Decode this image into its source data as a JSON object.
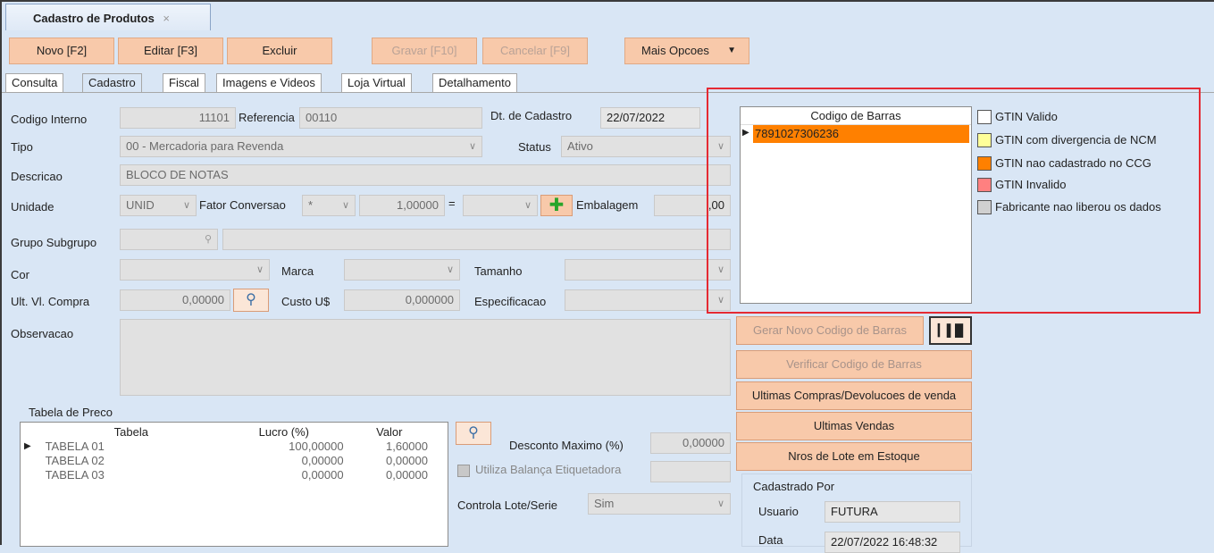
{
  "window": {
    "tab_title": "Cadastro de Produtos",
    "close_glyph": "×"
  },
  "toolbar": {
    "novo": "Novo [F2]",
    "editar": "Editar [F3]",
    "excluir": "Excluir",
    "gravar": "Gravar [F10]",
    "cancelar": "Cancelar [F9]",
    "mais": "Mais Opcoes"
  },
  "tabs": [
    "Consulta",
    "Cadastro",
    "Fiscal",
    "Imagens e Videos",
    "Loja Virtual",
    "Detalhamento"
  ],
  "form": {
    "codigo_interno_label": "Codigo Interno",
    "codigo_interno": "11101",
    "referencia_label": "Referencia",
    "referencia": "00110",
    "dt_cadastro_label": "Dt. de Cadastro",
    "dt_cadastro": "22/07/2022",
    "tipo_label": "Tipo",
    "tipo": "00 - Mercadoria para Revenda",
    "status_label": "Status",
    "status": "Ativo",
    "descricao_label": "Descricao",
    "descricao": "BLOCO DE NOTAS",
    "unidade_label": "Unidade",
    "unidade": "UNID",
    "fator_label": "Fator Conversao",
    "fator_op": "*",
    "fator_valor": "1,00000",
    "equals": "=",
    "embalagem_label": "Embalagem",
    "embalagem": ",00",
    "grupo_label": "Grupo Subgrupo",
    "cor_label": "Cor",
    "marca_label": "Marca",
    "tamanho_label": "Tamanho",
    "ult_compra_label": "Ult. Vl. Compra",
    "ult_compra": "0,00000",
    "custo_label": "Custo U$",
    "custo": "0,000000",
    "especificacao_label": "Especificacao",
    "observacao_label": "Observacao"
  },
  "preco": {
    "title": "Tabela de Preco",
    "headers": [
      "Tabela",
      "Lucro (%)",
      "Valor"
    ],
    "rows": [
      {
        "tabela": "TABELA 01",
        "lucro": "100,00000",
        "valor": "1,60000"
      },
      {
        "tabela": "TABELA 02",
        "lucro": "0,00000",
        "valor": "0,00000"
      },
      {
        "tabela": "TABELA 03",
        "lucro": "0,00000",
        "valor": "0,00000"
      }
    ]
  },
  "desconto": {
    "label": "Desconto Maximo (%)",
    "value": "0,00000"
  },
  "balanca_label": "Utiliza Balança Etiquetadora",
  "lote": {
    "label": "Controla Lote/Serie",
    "value": "Sim"
  },
  "barras": {
    "header": "Codigo de Barras",
    "items": [
      "7891027306236"
    ]
  },
  "legend": [
    {
      "label": "GTIN Valido",
      "color": "#ffffff"
    },
    {
      "label": "GTIN com divergencia de NCM",
      "color": "#ffff99"
    },
    {
      "label": "GTIN nao cadastrado no CCG",
      "color": "#ff8000"
    },
    {
      "label": "GTIN Invalido",
      "color": "#ff8080"
    },
    {
      "label": "Fabricante nao liberou os dados",
      "color": "#d0d0d0"
    }
  ],
  "actions": {
    "gerar": "Gerar Novo Codigo de Barras",
    "verificar": "Verificar Codigo de Barras",
    "ultimas_compras": "Ultimas Compras/Devolucoes de venda",
    "ultimas_vendas": "Ultimas Vendas",
    "lotes": "Nros de Lote em Estoque"
  },
  "cadastrado": {
    "title": "Cadastrado Por",
    "usuario_label": "Usuario",
    "usuario": "FUTURA",
    "data_label": "Data",
    "data": "22/07/2022 16:48:32"
  },
  "colors": {
    "accent_button": "#f8c9aa",
    "highlight": "#e52a33",
    "selected_row": "#ff8000"
  }
}
